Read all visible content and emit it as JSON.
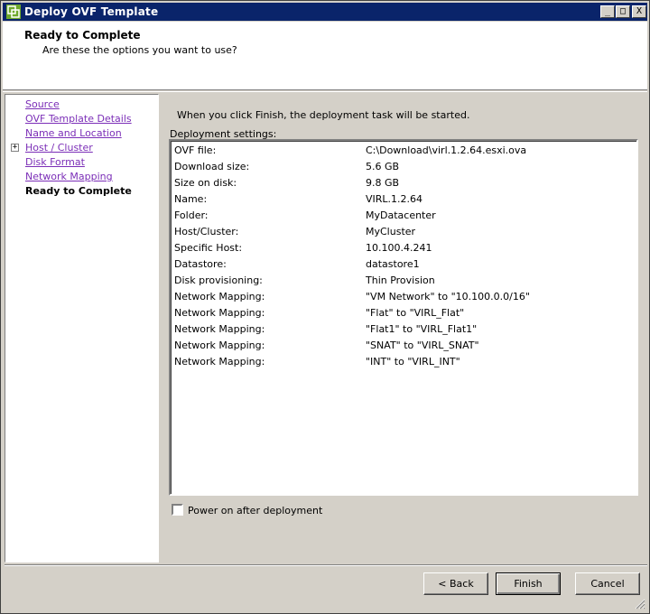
{
  "window": {
    "title": "Deploy OVF Template",
    "min_glyph": "_",
    "max_glyph": "□",
    "close_glyph": "X"
  },
  "header": {
    "title": "Ready to Complete",
    "subtitle": "Are these the options you want to use?"
  },
  "nav": {
    "items": [
      {
        "label": "Source"
      },
      {
        "label": "OVF Template Details"
      },
      {
        "label": "Name and Location"
      },
      {
        "label": "Host / Cluster"
      },
      {
        "label": "Disk Format"
      },
      {
        "label": "Network Mapping"
      }
    ],
    "current": "Ready to Complete",
    "expand_glyph": "+"
  },
  "main": {
    "intro": "When you click Finish, the deployment task will be started.",
    "settings_label": "Deployment settings:",
    "settings": [
      {
        "key": "OVF file:",
        "value": "C:\\Download\\virl.1.2.64.esxi.ova"
      },
      {
        "key": "Download size:",
        "value": "5.6 GB"
      },
      {
        "key": "Size on disk:",
        "value": "9.8 GB"
      },
      {
        "key": "Name:",
        "value": "VIRL.1.2.64"
      },
      {
        "key": "Folder:",
        "value": "MyDatacenter"
      },
      {
        "key": "Host/Cluster:",
        "value": "MyCluster"
      },
      {
        "key": "Specific Host:",
        "value": "10.100.4.241"
      },
      {
        "key": "Datastore:",
        "value": "datastore1"
      },
      {
        "key": "Disk provisioning:",
        "value": "Thin Provision"
      },
      {
        "key": "Network Mapping:",
        "value": "\"VM Network\" to \"10.100.0.0/16\""
      },
      {
        "key": "Network Mapping:",
        "value": "\"Flat\" to \"VIRL_Flat\""
      },
      {
        "key": "Network Mapping:",
        "value": "\"Flat1\" to \"VIRL_Flat1\""
      },
      {
        "key": "Network Mapping:",
        "value": "\"SNAT\" to \"VIRL_SNAT\""
      },
      {
        "key": "Network Mapping:",
        "value": "\"INT\" to \"VIRL_INT\""
      }
    ],
    "power_on_label": "Power on after deployment",
    "power_on_checked": false
  },
  "buttons": {
    "back": "< Back",
    "finish": "Finish",
    "cancel": "Cancel"
  },
  "colors": {
    "titlebar": "#0a246a",
    "link_visited": "#7b2eb7",
    "face": "#d4d0c8"
  },
  "icons": {
    "title": "vsphere-client-icon",
    "grip": "resize-grip-icon"
  }
}
